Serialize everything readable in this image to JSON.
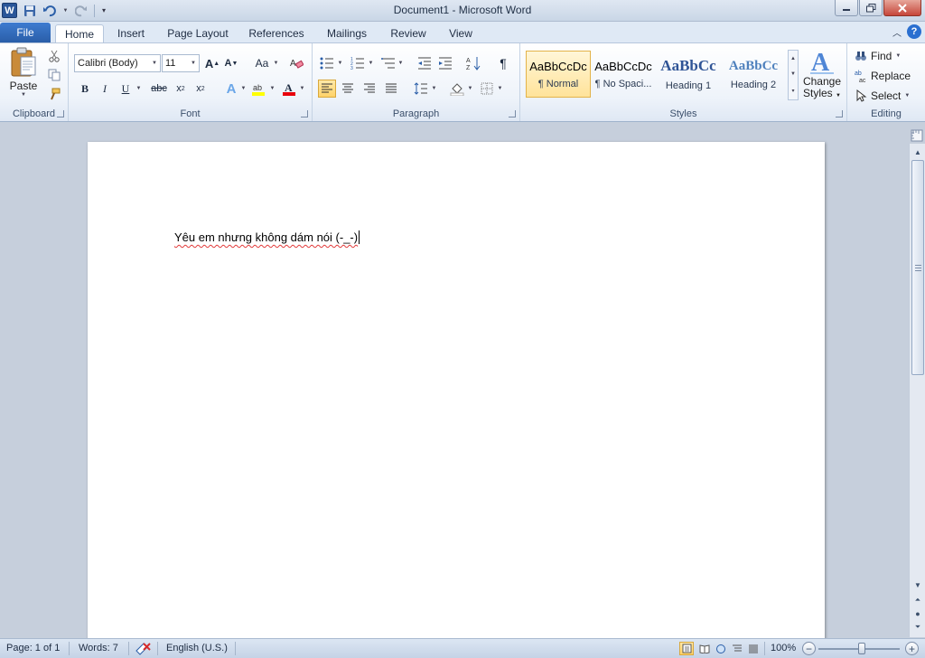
{
  "window": {
    "title": "Document1  -  Microsoft Word",
    "app_icon_letter": "W"
  },
  "tabs": {
    "file": "File",
    "items": [
      "Home",
      "Insert",
      "Page Layout",
      "References",
      "Mailings",
      "Review",
      "View"
    ],
    "active": "Home"
  },
  "ribbon": {
    "clipboard": {
      "paste_label": "Paste",
      "group_label": "Clipboard"
    },
    "font": {
      "font_name": "Calibri (Body)",
      "font_size": "11",
      "group_label": "Font"
    },
    "paragraph": {
      "group_label": "Paragraph"
    },
    "styles": {
      "group_label": "Styles",
      "gallery": [
        {
          "sample": "AaBbCcDc",
          "name": "¶ Normal",
          "color": "#000000",
          "selected": true
        },
        {
          "sample": "AaBbCcDc",
          "name": "¶ No Spaci...",
          "color": "#000000",
          "selected": false
        },
        {
          "sample": "AaBbCc",
          "name": "Heading 1",
          "color": "#2f5496",
          "selected": false
        },
        {
          "sample": "AaBbCc",
          "name": "Heading 2",
          "color": "#4f81bd",
          "selected": false
        }
      ],
      "change_styles_line1": "Change",
      "change_styles_line2": "Styles"
    },
    "editing": {
      "find": "Find",
      "replace": "Replace",
      "select": "Select",
      "group_label": "Editing"
    }
  },
  "document": {
    "text": "Yêu em nhưng không dám nói (-_-)"
  },
  "statusbar": {
    "page": "Page: 1 of 1",
    "words": "Words: 7",
    "language": "English (U.S.)",
    "zoom": "100%"
  },
  "colors": {
    "file_tab": "#2a5ea8",
    "ribbon_bg": "#eef3fa",
    "workspace": "#c6cfdc",
    "font_color_bar": "#e8000b",
    "highlight_bar": "#ffff00"
  }
}
